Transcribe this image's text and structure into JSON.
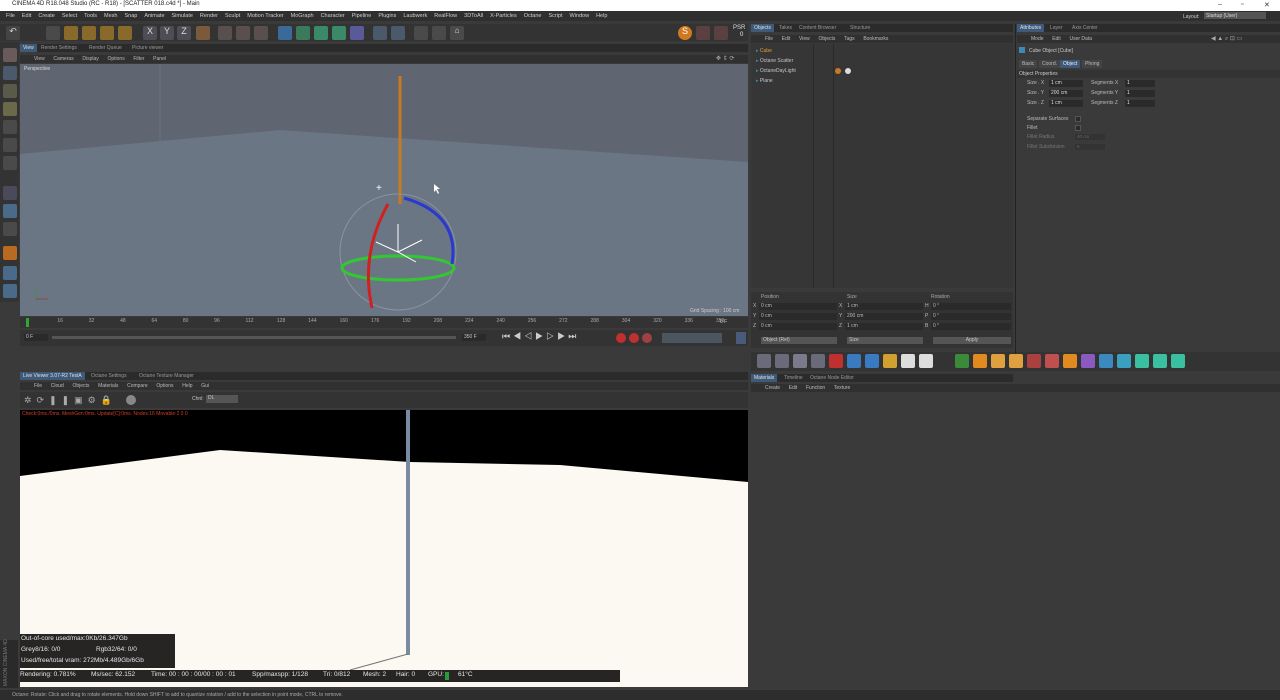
{
  "window": {
    "title": "CINEMA 4D R18.048 Studio (RC - R18) - [SCATTER 018.c4d *] - Main"
  },
  "menu": [
    "File",
    "Edit",
    "Create",
    "Select",
    "Tools",
    "Mesh",
    "Snap",
    "Animate",
    "Simulate",
    "Render",
    "Sculpt",
    "Motion Tracker",
    "MoGraph",
    "Character",
    "Pipeline",
    "Plugins",
    "Laubwerk",
    "RealFlow",
    "3DToAll",
    "X-Particles",
    "Octane",
    "Script",
    "Window",
    "Help"
  ],
  "layout": {
    "label": "Layout:",
    "value": "Startup (User)"
  },
  "psr": {
    "label": "PSR",
    "value": "0"
  },
  "viewport": {
    "tabs": [
      "View",
      "Render Settings",
      "Render Queue",
      "Picture viewer"
    ],
    "menu": [
      "View",
      "Cameras",
      "Display",
      "Options",
      "Filter",
      "Panel"
    ],
    "name": "Perspective",
    "grid_spacing": "Grid Spacing : 100 cm"
  },
  "timeline": {
    "ticks": [
      "0",
      "16",
      "32",
      "48",
      "64",
      "80",
      "96",
      "112",
      "128",
      "144",
      "160",
      "176",
      "192",
      "208",
      "224",
      "240",
      "256",
      "272",
      "288",
      "304",
      "320",
      "336",
      "350"
    ],
    "frame_left": "0 F",
    "frame_end": "350 F",
    "current": "0 F"
  },
  "objects_panel": {
    "tabs": [
      "Objects",
      "Takes",
      "Content Browser",
      "Structure"
    ],
    "menu": [
      "File",
      "Edit",
      "View",
      "Objects",
      "Tags",
      "Bookmarks"
    ],
    "items": [
      {
        "name": "Cube",
        "color": "#e6a23c"
      },
      {
        "name": "Octane Scatter",
        "color": "#c8c8c8"
      },
      {
        "name": "OctaneDayLight",
        "color": "#c8c8c8"
      },
      {
        "name": "Plane",
        "color": "#c8c8c8"
      }
    ]
  },
  "attributes_panel": {
    "tabs": [
      "Attributes",
      "Layer",
      "Axis Center"
    ],
    "menu": [
      "Mode",
      "Edit",
      "User Data"
    ],
    "object_title": "Cube Object [Cube]",
    "subtabs": [
      "Basic",
      "Coord.",
      "Object",
      "Phong"
    ],
    "section": "Object Properties",
    "rows": [
      {
        "label": "Size . X",
        "value": "1 cm",
        "seg_label": "Segments X",
        "seg_value": "1"
      },
      {
        "label": "Size . Y",
        "value": "200 cm",
        "seg_label": "Segments Y",
        "seg_value": "1"
      },
      {
        "label": "Size . Z",
        "value": "1 cm",
        "seg_label": "Segments Z",
        "seg_value": "1"
      }
    ],
    "checks": [
      "Separate Surfaces",
      "Fillet",
      "Fillet Radius",
      "Fillet Subdivision"
    ],
    "fillet_radius": "40 cm",
    "fillet_sub": "5"
  },
  "coords": {
    "headers": [
      "Position",
      "Size",
      "Rotation"
    ],
    "rows": [
      {
        "axis": "X",
        "pos": "0 cm",
        "size": "1 cm",
        "rot_axis": "H",
        "rot": "0 °"
      },
      {
        "axis": "Y",
        "pos": "0 cm",
        "size": "200 cm",
        "rot_axis": "P",
        "rot": "0 °"
      },
      {
        "axis": "Z",
        "pos": "0 cm",
        "size": "1 cm",
        "rot_axis": "B",
        "rot": "0 °"
      }
    ],
    "mode": "Object (Rel)",
    "size_mode": "Size",
    "apply": "Apply"
  },
  "materials_panel": {
    "tabs": [
      "Materials",
      "Timeline",
      "Octane Node Editor"
    ],
    "menu": [
      "Create",
      "Edit",
      "Function",
      "Texture"
    ]
  },
  "live_viewer": {
    "tabs": [
      "Live Viewer 3.07-R2 TestA",
      "Octane Settings",
      "Octane Texture Manager"
    ],
    "menu": [
      "File",
      "Cloud",
      "Objects",
      "Materials",
      "Compare",
      "Options",
      "Help",
      "Gui"
    ],
    "channel_label": "Chnl:",
    "channel_value": "DL",
    "info_line": "Check:0ms./0ms. MeshGen:0ms. Update[C]:0ms. Nodes:16 Movable:2 0 0",
    "stats": [
      "Out-of-core used/max:0Kb/26.347Gb",
      "Grey8/16: 0/0",
      "Rgb32/64: 0/0",
      "Used/free/total vram: 272Mb/4.489Gb/6Gb"
    ],
    "render_line": {
      "rendering": "Rendering: 0.781%",
      "ms": "Ms/sec: 62.152",
      "time": "Time: 00 : 00 : 00/00 : 00 : 01",
      "spp": "Spp/maxspp: 1/128",
      "tri": "Tri: 0/812",
      "mesh": "Mesh: 2",
      "hair": "Hair: 0",
      "gpu": "GPU:",
      "temp": "61°C"
    }
  },
  "status_bar": "Octane:      Rotate: Click and drag to rotate elements. Hold down SHIFT to add to quantize rotation / add to the selection in point mode, CTRL to remove.",
  "side_brand": "MAXON CINEMA 4D",
  "colors": {
    "accent": "#3e5a7a",
    "render_bg": "#fbf9f1",
    "orange": "#e6a23c"
  }
}
